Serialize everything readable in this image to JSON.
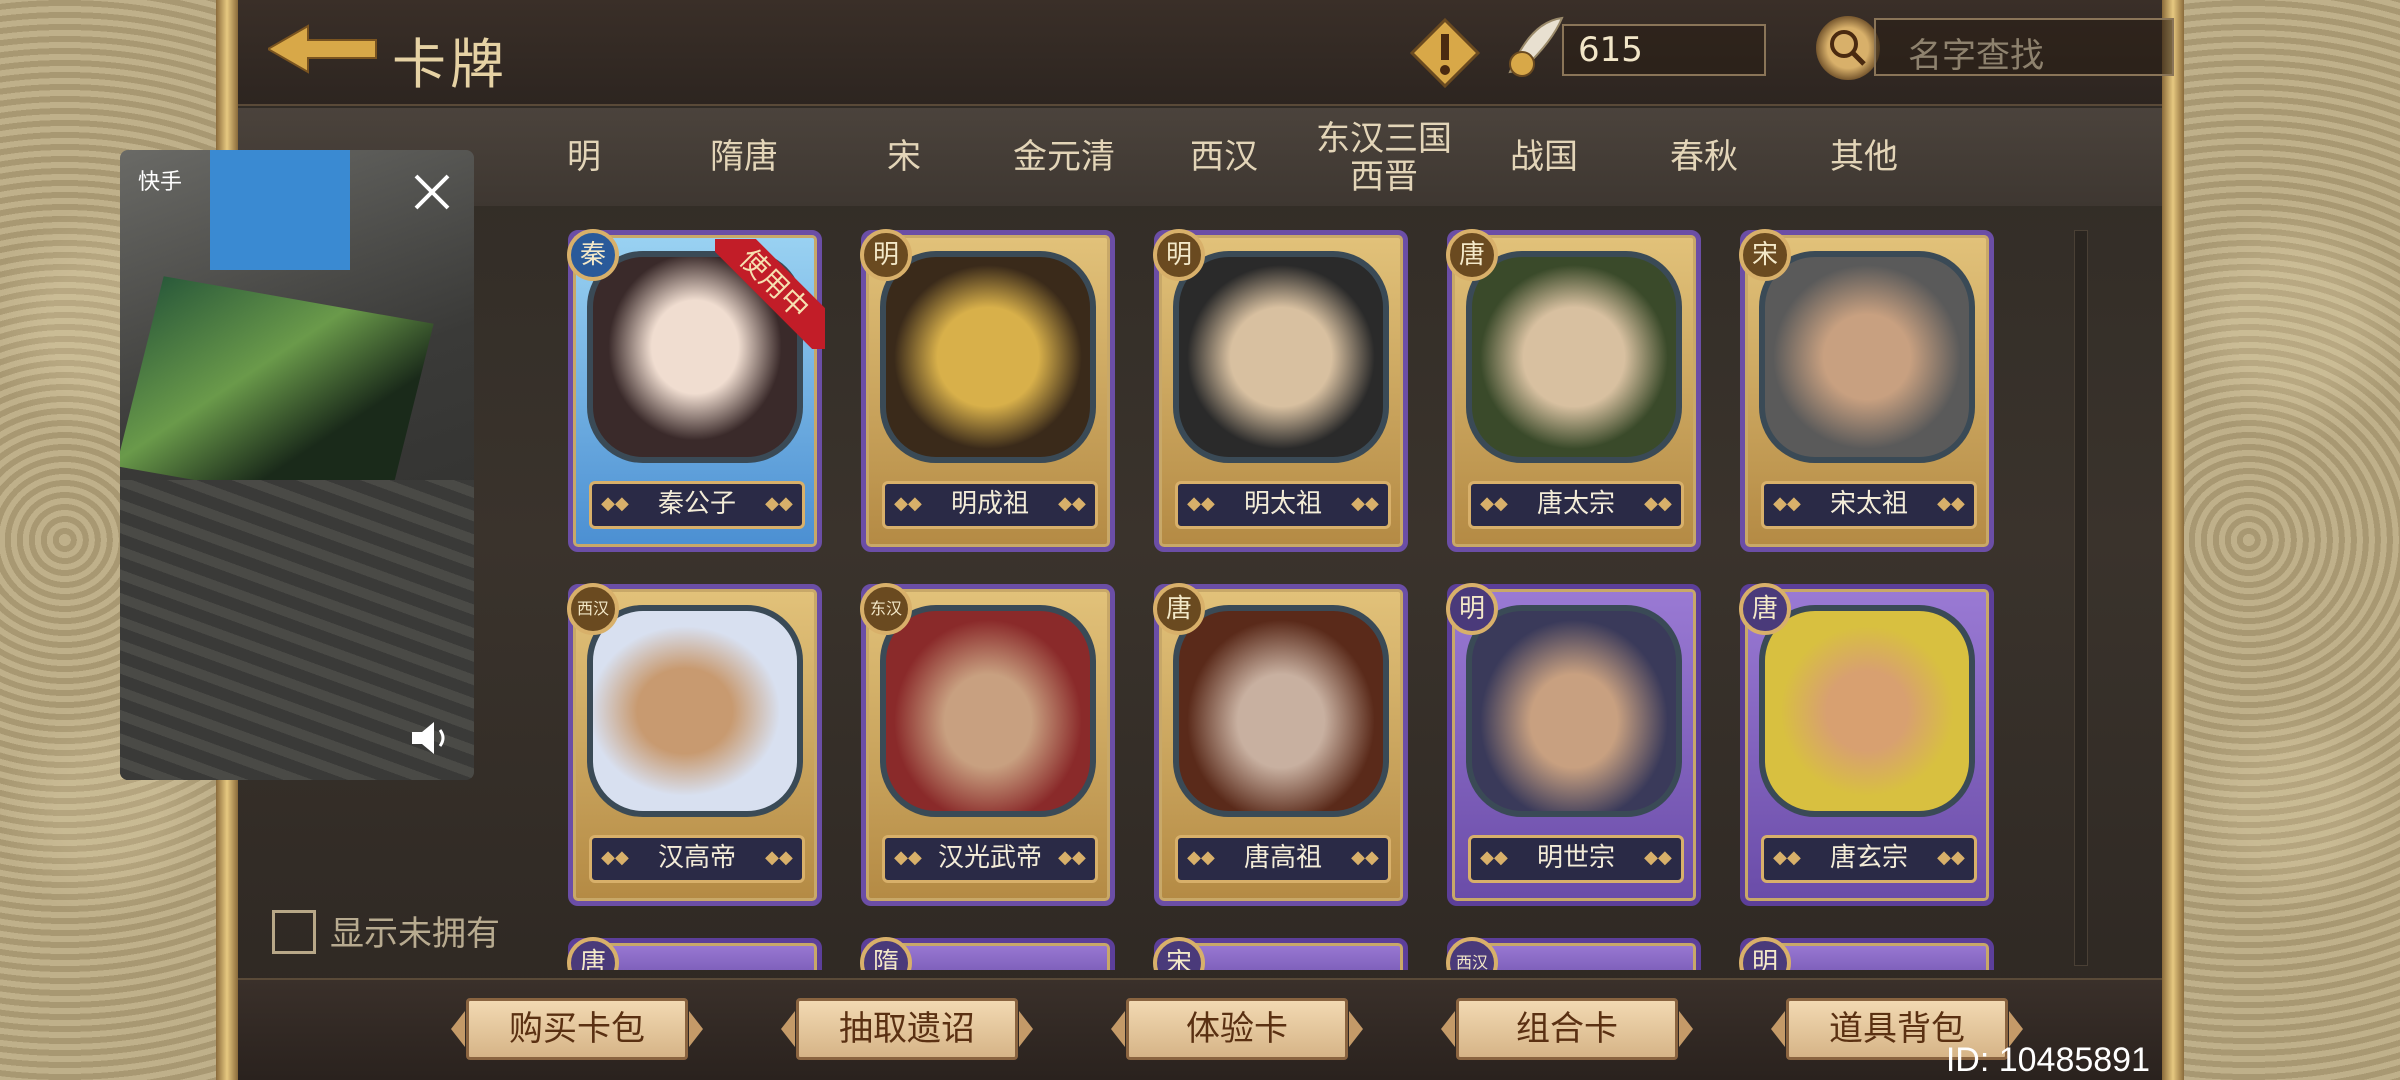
{
  "header": {
    "title": "卡牌",
    "currency": "615",
    "search_placeholder": "名字查找"
  },
  "tabs": [
    {
      "label": "明"
    },
    {
      "label": "隋唐"
    },
    {
      "label": "宋"
    },
    {
      "label": "金元清"
    },
    {
      "label": "西汉"
    },
    {
      "label": "东汉三国",
      "label2": "西晋"
    },
    {
      "label": "战国"
    },
    {
      "label": "春秋"
    },
    {
      "label": "其他"
    }
  ],
  "cards": [
    {
      "name": "秦公子",
      "dynasty": "秦",
      "status": "使用中"
    },
    {
      "name": "明成祖",
      "dynasty": "明"
    },
    {
      "name": "明太祖",
      "dynasty": "明"
    },
    {
      "name": "唐太宗",
      "dynasty": "唐"
    },
    {
      "name": "宋太祖",
      "dynasty": "宋"
    },
    {
      "name": "汉高帝",
      "dynasty": "西汉"
    },
    {
      "name": "汉光武帝",
      "dynasty": "东汉"
    },
    {
      "name": "唐高祖",
      "dynasty": "唐"
    },
    {
      "name": "明世宗",
      "dynasty": "明"
    },
    {
      "name": "唐玄宗",
      "dynasty": "唐"
    }
  ],
  "partial_badges": [
    "唐",
    "隋",
    "宋",
    "西汉",
    "明"
  ],
  "show_unowned_label": "显示未拥有",
  "bottom_buttons": [
    "购买卡包",
    "抽取遗诏",
    "体验卡",
    "组合卡",
    "道具背包"
  ],
  "user_id": "ID: 10485891",
  "video_overlay": {
    "brand": "快手"
  }
}
